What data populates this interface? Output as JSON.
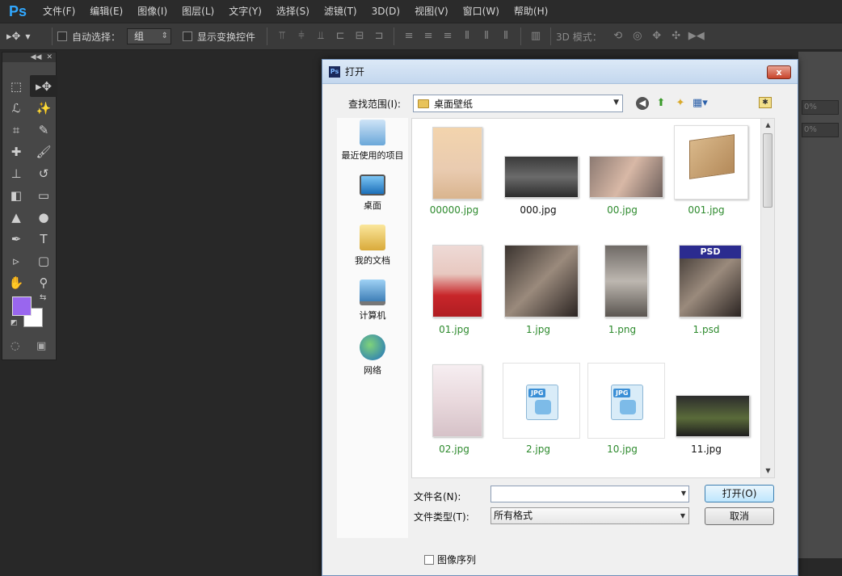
{
  "app": {
    "logo": "Ps"
  },
  "menu": [
    "文件(F)",
    "编辑(E)",
    "图像(I)",
    "图层(L)",
    "文字(Y)",
    "选择(S)",
    "滤镜(T)",
    "3D(D)",
    "视图(V)",
    "窗口(W)",
    "帮助(H)"
  ],
  "options": {
    "auto_select_label": "自动选择：",
    "auto_select_value": "组",
    "show_transform_label": "显示变换控件",
    "mode_3d_label": "3D 模式："
  },
  "colors": {
    "foreground": "#9966ee",
    "background": "#ffffff",
    "accent": "#31a8ff"
  },
  "dialog": {
    "title": "打开",
    "close_glyph": "x",
    "lookin_label": "查找范围(I):",
    "lookin_value": "桌面壁纸",
    "places": [
      "最近使用的项目",
      "桌面",
      "我的文档",
      "计算机",
      "网络"
    ],
    "files": [
      {
        "name": "00000.jpg",
        "kind": "portrait-warm",
        "color": "green"
      },
      {
        "name": "000.jpg",
        "kind": "street-dark",
        "color": "black"
      },
      {
        "name": "00.jpg",
        "kind": "portrait-skin",
        "color": "green"
      },
      {
        "name": "001.jpg",
        "kind": "cardboard-box",
        "color": "green"
      },
      {
        "name": "01.jpg",
        "kind": "portrait-red",
        "color": "green"
      },
      {
        "name": "1.jpg",
        "kind": "portrait-bw",
        "color": "green"
      },
      {
        "name": "1.png",
        "kind": "street-walk",
        "color": "green"
      },
      {
        "name": "1.psd",
        "kind": "psd",
        "color": "green",
        "band": "PSD"
      },
      {
        "name": "02.jpg",
        "kind": "portrait-pale",
        "color": "green"
      },
      {
        "name": "2.jpg",
        "kind": "jpg-icon",
        "color": "green",
        "tag": "JPG"
      },
      {
        "name": "10.jpg",
        "kind": "jpg-icon",
        "color": "green",
        "tag": "JPG"
      },
      {
        "name": "11.jpg",
        "kind": "street-rain",
        "color": "black"
      }
    ],
    "filename_label": "文件名(N):",
    "filename_value": "",
    "filetype_label": "文件类型(T):",
    "filetype_value": "所有格式",
    "open_button": "打开(O)",
    "cancel_button": "取消",
    "image_sequence_label": "图像序列"
  }
}
